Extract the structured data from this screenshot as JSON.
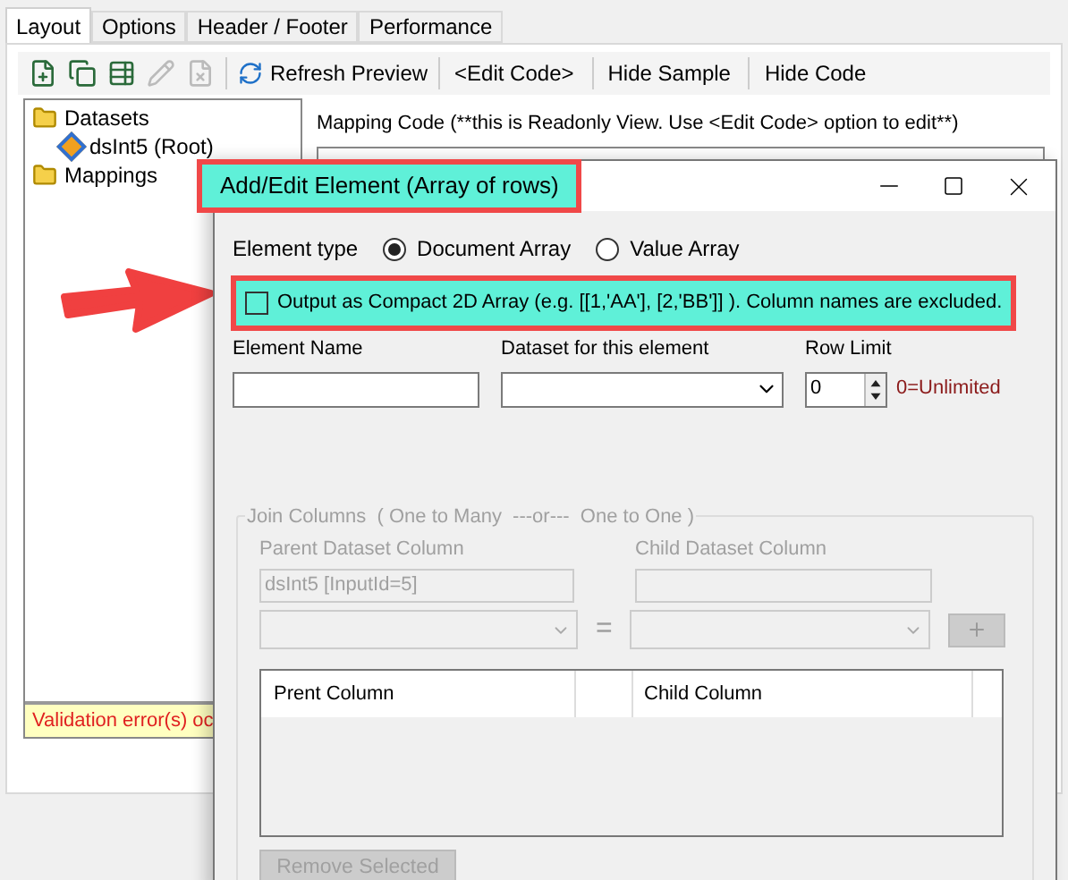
{
  "tabs": [
    {
      "label": "Layout",
      "selected": true
    },
    {
      "label": "Options",
      "selected": false
    },
    {
      "label": "Header / Footer",
      "selected": false
    },
    {
      "label": "Performance",
      "selected": false
    }
  ],
  "toolbar": [
    {
      "kind": "icon",
      "disabled": false
    },
    {
      "kind": "icon",
      "disabled": false
    },
    {
      "kind": "icon",
      "disabled": false
    },
    {
      "kind": "icon",
      "disabled": true
    },
    {
      "kind": "icon",
      "disabled": true
    },
    {
      "kind": "iconbutton",
      "label": "Refresh Preview"
    },
    {
      "kind": "button",
      "label": "<Edit Code>"
    },
    {
      "kind": "button",
      "label": "Hide Sample"
    },
    {
      "kind": "button",
      "label": "Hide Code"
    }
  ],
  "tree": [
    {
      "label": "Datasets",
      "kind": "folder",
      "children": [
        {
          "label": "dsInt5 (Root)",
          "kind": "dataset"
        }
      ]
    },
    {
      "label": "Mappings",
      "kind": "folder"
    }
  ],
  "validation": "Validation error(s) oc",
  "mapping_label": "Mapping Code (**this is Readonly View. Use <Edit Code> option to edit**)",
  "dialog": {
    "title": "Add/Edit Element (Array of rows)",
    "element_type_label": "Element type",
    "element_types": [
      {
        "label": "Document Array",
        "selected": true
      },
      {
        "label": "Value Array",
        "selected": false
      }
    ],
    "compact": {
      "label": "Output as Compact 2D Array (e.g. [[1,'AA'], [2,'BB']] ). Column names are excluded.",
      "checked": false
    },
    "element_name_label": "Element Name",
    "dataset_label": "Dataset for this element",
    "row_limit_label": "Row Limit",
    "row_limit": "0",
    "row_limit_hint": "0=Unlimited",
    "join": {
      "legend": "Join Columns  ( One to Many  ---or---  One to One )",
      "disabled": true,
      "parent_label": "Parent Dataset Column",
      "parent_value": "dsInt5 [InputId=5]",
      "child_label": "Child Dataset Column",
      "equals": "=",
      "columns": [
        "Prent Column",
        "Child Column"
      ],
      "remove": "Remove Selected"
    }
  }
}
